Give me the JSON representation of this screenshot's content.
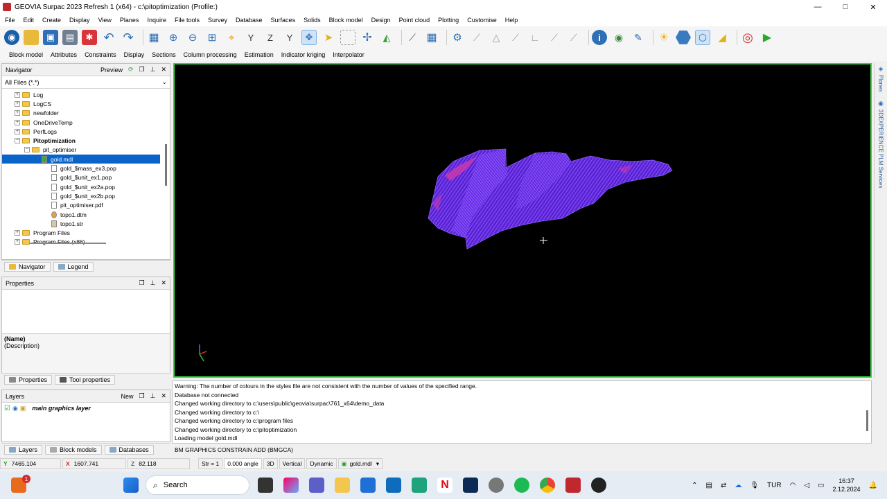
{
  "window": {
    "title": "GEOVIA Surpac 2023 Refresh 1 (x64) - c:\\pitoptimization (Profile:)",
    "minimize": "—",
    "maximize": "□",
    "close": "✕"
  },
  "menu": [
    "File",
    "Edit",
    "Create",
    "Display",
    "View",
    "Planes",
    "Inquire",
    "File tools",
    "Survey",
    "Database",
    "Surfaces",
    "Solids",
    "Block model",
    "Design",
    "Point cloud",
    "Plotting",
    "Customise",
    "Help"
  ],
  "subtoolbar": [
    "Block model",
    "Attributes",
    "Constraints",
    "Display",
    "Sections",
    "Column processing",
    "Estimation",
    "Indicator kriging",
    "Interpolator"
  ],
  "navigator": {
    "title": "Navigator",
    "preview": "Preview",
    "filter": "All Files (*.*)",
    "items": [
      {
        "label": "Log",
        "type": "folder",
        "indent": 1,
        "expander": "+"
      },
      {
        "label": "LogCS",
        "type": "folder",
        "indent": 1,
        "expander": "+"
      },
      {
        "label": "newfolder",
        "type": "folder",
        "indent": 1,
        "expander": "+"
      },
      {
        "label": "OneDriveTemp",
        "type": "folder",
        "indent": 1,
        "expander": "+"
      },
      {
        "label": "PerfLogs",
        "type": "folder",
        "indent": 1,
        "expander": "+"
      },
      {
        "label": "Pitoptimization",
        "type": "folder",
        "indent": 1,
        "expander": "−",
        "bold": true
      },
      {
        "label": "pit_optimiser",
        "type": "folder",
        "indent": 2,
        "expander": "−"
      },
      {
        "label": "gold.mdl",
        "type": "model",
        "indent": 3,
        "selected": true
      },
      {
        "label": "gold_$mass_ex3.pop",
        "type": "file",
        "indent": 4
      },
      {
        "label": "gold_$unit_ex1.pop",
        "type": "file",
        "indent": 4
      },
      {
        "label": "gold_$unit_ex2a.pop",
        "type": "file",
        "indent": 4
      },
      {
        "label": "gold_$unit_ex2b.pop",
        "type": "file",
        "indent": 4
      },
      {
        "label": "pit_optimiser.pdf",
        "type": "file",
        "indent": 4
      },
      {
        "label": "topo1.dtm",
        "type": "dtm",
        "indent": 4
      },
      {
        "label": "topo1.str",
        "type": "str",
        "indent": 4
      },
      {
        "label": "Program Files",
        "type": "folder",
        "indent": 1,
        "expander": "+"
      },
      {
        "label": "Program Files (x86)",
        "type": "folder",
        "indent": 1,
        "expander": "+"
      }
    ],
    "tabs": [
      "Navigator",
      "Legend"
    ]
  },
  "properties": {
    "title": "Properties",
    "name": "(Name)",
    "description": "(Description)",
    "tabs": [
      "Properties",
      "Tool properties"
    ]
  },
  "layers": {
    "title": "Layers",
    "new_label": "New",
    "items": [
      "main graphics layer"
    ],
    "tabs": [
      "Layers",
      "Block models",
      "Databases"
    ]
  },
  "side_panels": [
    "Planes",
    "3DEXPERIENCE PLM Services"
  ],
  "console": {
    "lines": [
      "Warning: The number of colours in the styles file are not consistent with the number of values of the specified range.",
      "Database not connected",
      "Changed working directory to c:\\users\\public\\geovia\\surpac\\761_x64\\demo_data",
      "Changed working directory to c:\\",
      "Changed working directory to c:\\program files",
      "Changed working directory to c:\\pitoptimization",
      "Loading model gold.mdl"
    ],
    "command": "BM GRAPHICS CONSTRAIN ADD (BMGCA)"
  },
  "status": {
    "y": "7465.104",
    "x": "1607.741",
    "z": "82.118",
    "str_label": "Str = 1",
    "angle": "0.000 angle",
    "mode_3d": "3D",
    "vertical": "Vertical",
    "dynamic": "Dynamic",
    "model": "gold.mdl"
  },
  "taskbar": {
    "search": "Search",
    "lang": "TUR",
    "time": "16:37",
    "date": "2.12.2024",
    "badge": "1"
  },
  "colors": {
    "viewport_bg": "#000000",
    "viewport_border": "#3bd13b",
    "selection": "#0a64c8",
    "model_purple": "#6a2cf0",
    "model_pink": "#e03aa0"
  }
}
